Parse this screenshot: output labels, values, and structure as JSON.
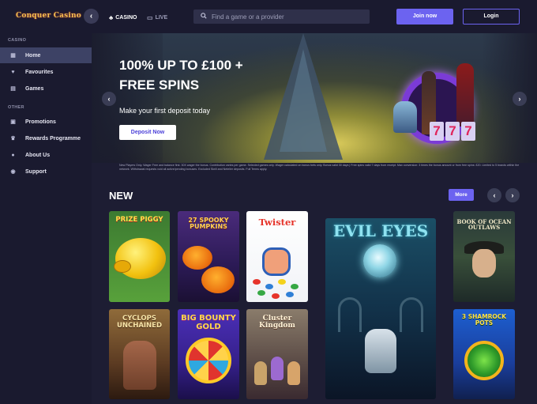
{
  "header": {
    "logo_text": "Conquer Casino",
    "collapse_icon": "chevron-left-icon",
    "tabs": [
      {
        "label": "CASINO",
        "icon": "spade-icon"
      },
      {
        "label": "LIVE",
        "icon": "tv-icon"
      }
    ],
    "search": {
      "placeholder": "Find a game or a provider"
    },
    "join_label": "Join now",
    "login_label": "Login"
  },
  "sidebar": {
    "heading_casino": "CASINO",
    "heading_other": "OTHER",
    "items": [
      {
        "label": "Home",
        "icon": "grid-icon",
        "active": true
      },
      {
        "label": "Favourites",
        "icon": "heart-icon"
      },
      {
        "label": "Games",
        "icon": "games-icon"
      },
      {
        "label": "Promotions",
        "icon": "gift-icon"
      },
      {
        "label": "Rewards Programme",
        "icon": "trophy-icon"
      },
      {
        "label": "About Us",
        "icon": "info-icon"
      },
      {
        "label": "Support",
        "icon": "support-icon"
      }
    ]
  },
  "banner": {
    "headline_line1": "100% UP TO £100 +",
    "headline_line2": "FREE SPINS",
    "subtext": "Make your first deposit today",
    "cta_label": "Deposit Now",
    "terms": "New Players Only. Wager Free and balance first. 30X wager the bonus. Contribution varies per game. Selected games only. Wager calculated on bonus bets only. Bonus valid 30 days | Free spins valid 7 days from receipt. Max conversion: 3 times the bonus amount or from free spins: £20. Limited to 5 brands within the network. Withdrawal requests void all active/pending bonuses. Excluded Skrill and Neteller deposits. Full Terms apply."
  },
  "new_section": {
    "title": "NEW",
    "more_label": "More",
    "games": [
      {
        "title": "PRIZE PIGGY"
      },
      {
        "title": "27 SPOOKY PUMPKINS"
      },
      {
        "title": "Twister"
      },
      {
        "title": "EVIL EYES"
      },
      {
        "title": "BOOK OF OCEAN OUTLAWS"
      },
      {
        "title": "CYCLOPS UNCHAINED"
      },
      {
        "title": "BIG BOUNTY GOLD"
      },
      {
        "title": "Cluster Kingdom"
      },
      {
        "title": "3 SHAMROCK POTS"
      }
    ]
  },
  "colors": {
    "accent": "#6c63f0",
    "background": "#1d1d33",
    "sidebar": "#1a1a2f",
    "active_item": "#3d4265"
  }
}
